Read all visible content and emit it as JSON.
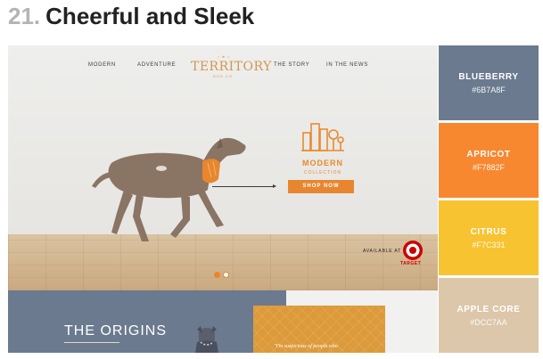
{
  "heading": {
    "number": "21.",
    "title": "Cheerful and Sleek"
  },
  "hero": {
    "nav_left": [
      "MODERN",
      "ADVENTURE"
    ],
    "nav_right": [
      "THE STORY",
      "IN THE NEWS"
    ],
    "logo": {
      "top": "• ★ •",
      "main": "TERRITORY",
      "sub": "DOG CO."
    },
    "collection_title": "MODERN",
    "collection_sub": "COLLECTION",
    "shop_label": "SHOP NOW",
    "available_label": "AVAILABLE AT",
    "target_word": "TARGET",
    "slide_dots": 2,
    "active_slide": 1
  },
  "bottom": {
    "origins_title": "THE ORIGINS",
    "quote": "\"I'm suspicious of people who"
  },
  "palette": [
    {
      "name": "BLUEBERRY",
      "hex": "#6B7A8F",
      "color": "#6b7a8f"
    },
    {
      "name": "APRICOT",
      "hex": "#F7882F",
      "color": "#f7882f"
    },
    {
      "name": "CITRUS",
      "hex": "#F7C331",
      "color": "#f7c331"
    },
    {
      "name": "APPLE CORE",
      "hex": "#DCC7AA",
      "color": "#dcc7aa"
    }
  ],
  "colors": {
    "accent_orange": "#e8862f",
    "logo_gold": "#d39654",
    "target_red": "#cc0000"
  }
}
